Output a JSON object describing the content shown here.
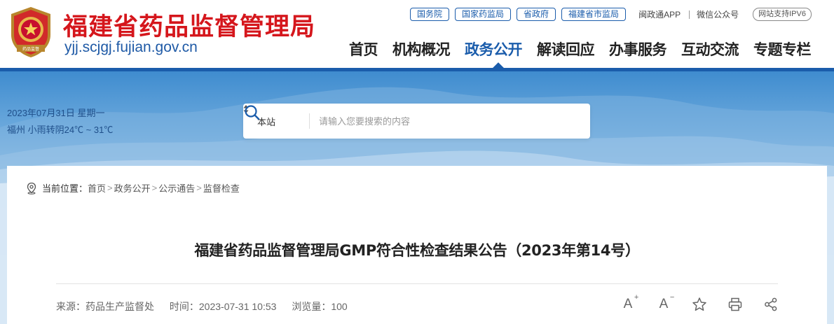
{
  "header": {
    "title": "福建省药品监督管理局",
    "domain": "yjj.scjgj.fujian.gov.cn",
    "emblem_text": "药品监督",
    "top_links": [
      "国务院",
      "国家药监局",
      "省政府",
      "福建省市监局"
    ],
    "app_link": "闽政通APP",
    "wechat_link": "微信公众号",
    "ipv6_badge": "网站支持IPV6"
  },
  "nav": {
    "items": [
      "首页",
      "机构概况",
      "政务公开",
      "解读回应",
      "办事服务",
      "互动交流",
      "专题专栏"
    ],
    "active": "政务公开"
  },
  "banner": {
    "date": "2023年07月31日 星期一",
    "weather": "福州 小雨转阴24℃ ~ 31℃"
  },
  "search": {
    "scope": "本站",
    "placeholder": "请输入您要搜索的内容"
  },
  "breadcrumb": {
    "prefix": "当前位置：",
    "items": [
      "首页",
      "政务公开",
      "公示通告",
      "监督检查"
    ]
  },
  "article": {
    "title": "福建省药品监督管理局GMP符合性检查结果公告（2023年第14号）",
    "source": "来源：药品生产监督处",
    "time": "时间：2023-07-31 10:53",
    "views": "浏览量：100"
  },
  "tools": {
    "font_larger": "A",
    "font_smaller": "A"
  },
  "colors": {
    "brand_red": "#d5161c",
    "brand_blue": "#1a5cab"
  },
  "icons": [
    "emblem-icon",
    "location-icon",
    "search-icon",
    "select-arrows-icon",
    "star-icon",
    "print-icon",
    "share-icon"
  ]
}
